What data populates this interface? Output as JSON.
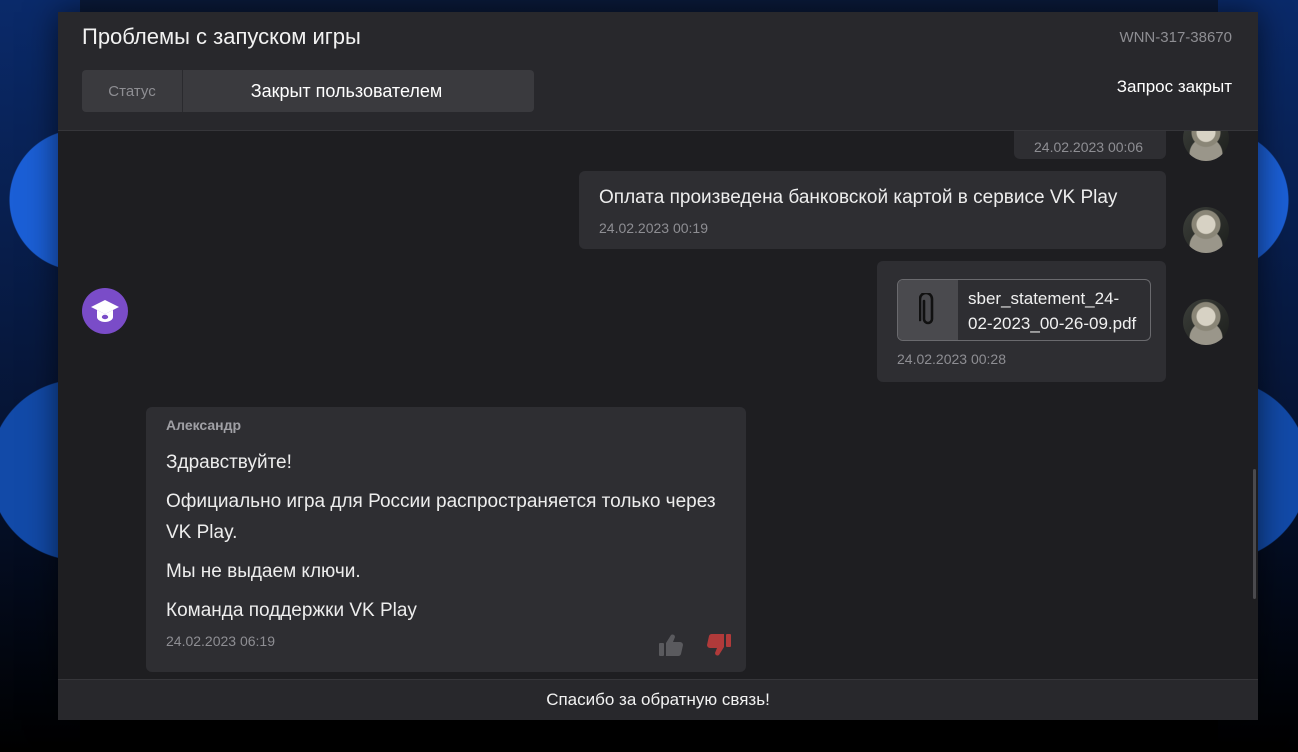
{
  "header": {
    "title": "Проблемы с запуском игры",
    "ticket_id": "WNN-317-38670",
    "status_label": "Статус",
    "status_value": "Закрыт пользователем",
    "closed_label": "Запрос закрыт"
  },
  "messages": [
    {
      "time": "24.02.2023 00:06"
    },
    {
      "text": "Оплата произведена банковской картой в сервисе VK Play",
      "time": "24.02.2023 00:19"
    },
    {
      "attachment": "sber_statement_24-02-2023_00-26-09.pdf",
      "time": "24.02.2023 00:28"
    }
  ],
  "agent_message": {
    "author": "Александр",
    "lines": [
      "Здравствуйте!",
      "Официально игра для России распространяется только через VK Play.",
      "Мы не выдаем ключи.",
      "Команда поддержки VK Play"
    ],
    "time": "24.02.2023 06:19"
  },
  "footer": {
    "text": "Спасибо за обратную связь!"
  },
  "icons": [
    "paperclip-icon",
    "graduation-cap-icon",
    "thumbs-up-icon",
    "thumbs-down-icon"
  ],
  "colors": {
    "accent_purple": "#7a4cc8",
    "dislike_red": "#b03a3a",
    "panel": "#1e1e21"
  }
}
